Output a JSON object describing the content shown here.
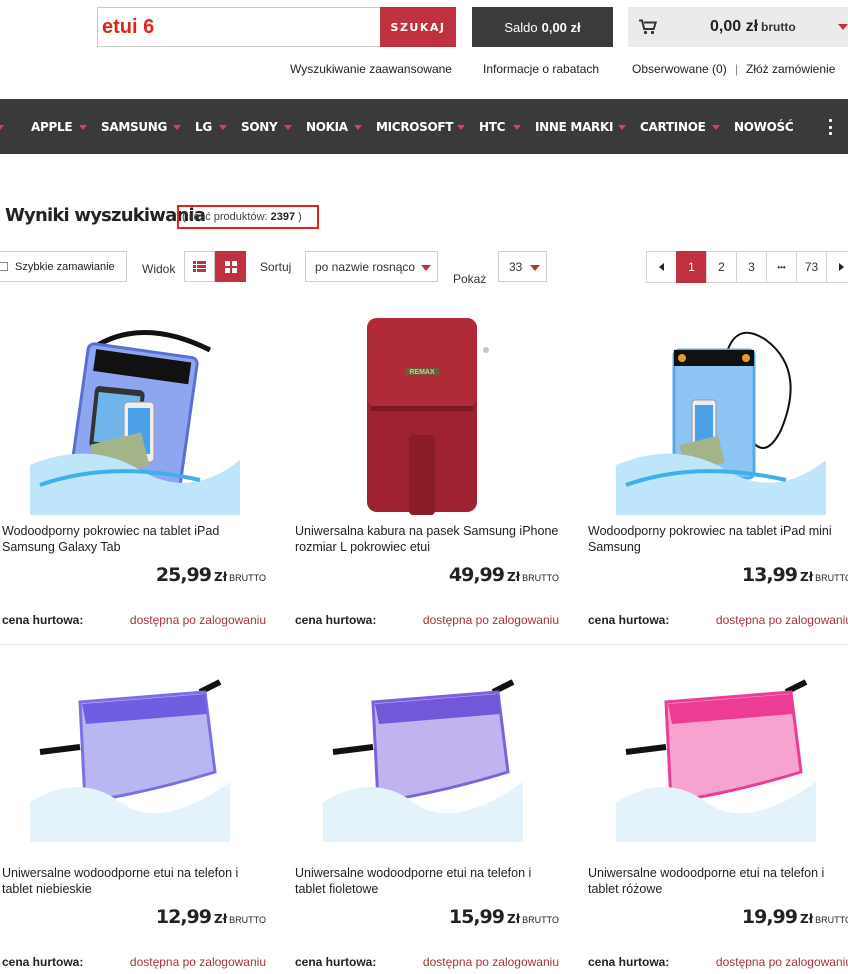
{
  "search": {
    "value": "etui 6",
    "button_label": "SZUKAJ"
  },
  "account": {
    "saldo_label": "Saldo",
    "saldo_value": "0,00 zł"
  },
  "cart": {
    "amount": "0,00 zł",
    "unit": "brutto"
  },
  "top_links": {
    "advanced_search": "Wyszukiwanie zaawansowane",
    "discounts": "Informacje o rabatach",
    "watched": "Obserwowane (0)",
    "separator": "|",
    "place_order": "Złóż zamówienie"
  },
  "nav": {
    "items": [
      "APPLE",
      "SAMSUNG",
      "LG",
      "SONY",
      "NOKIA",
      "MICROSOFT",
      "HTC",
      "INNE MARKI",
      "CARTINOE",
      "NOWOŚĆ"
    ]
  },
  "results": {
    "title": "Wyniki wyszukiwania",
    "count_prefix": "( ilość produktów:",
    "count_value": "2397",
    "count_suffix": ")"
  },
  "toolbar": {
    "quick_order": "Szybkie zamawianie",
    "view_label": "Widok",
    "sort_label": "Sortuj",
    "sort_value": "po nazwie rosnąco",
    "show_label": "Pokaż",
    "show_value": "33"
  },
  "pagination": {
    "pages": [
      "1",
      "2",
      "3",
      "•••",
      "73"
    ],
    "active": "1"
  },
  "products": [
    {
      "name": "Wodoodporny pokrowiec na tablet iPad Samsung Galaxy Tab",
      "price": "25,99",
      "currency": "Zł",
      "price_suffix": "BRUTTO",
      "wholesale_label": "cena hurtowa:",
      "wholesale_value": "dostępna po zalogowaniu"
    },
    {
      "name": "Uniwersalna kabura na pasek Samsung iPhone rozmiar L pokrowiec etui",
      "price": "49,99",
      "currency": "Zł",
      "price_suffix": "BRUTTO",
      "wholesale_label": "cena hurtowa:",
      "wholesale_value": "dostępna po zalogowaniu",
      "brand_mark": "REMAX"
    },
    {
      "name": "Wodoodporny pokrowiec na tablet iPad mini Samsung",
      "price": "13,99",
      "currency": "Zł",
      "price_suffix": "BRUTTO",
      "wholesale_label": "cena hurtowa:",
      "wholesale_value": "dostępna po zalogowaniu"
    },
    {
      "name": "Uniwersalne wodoodporne etui na telefon i tablet niebieskie",
      "price": "12,99",
      "currency": "Zł",
      "price_suffix": "BRUTTO",
      "wholesale_label": "cena hurtowa:",
      "wholesale_value": "dostępna po zalogowaniu"
    },
    {
      "name": "Uniwersalne wodoodporne etui na telefon i tablet fioletowe",
      "price": "15,99",
      "currency": "Zł",
      "price_suffix": "BRUTTO",
      "wholesale_label": "cena hurtowa:",
      "wholesale_value": "dostępna po zalogowaniu"
    },
    {
      "name": "Uniwersalne wodoodporne etui na telefon i tablet różowe",
      "price": "19,99",
      "currency": "Zł",
      "price_suffix": "BRUTTO",
      "wholesale_label": "cena hurtowa:",
      "wholesale_value": "dostępna po zalogowaniu"
    }
  ],
  "colors": {
    "accent": "#c0313f",
    "nav_bg": "#3a3a3a",
    "highlight": "#e2231a"
  },
  "icons": {
    "cart": "cart-icon",
    "list_view": "list-view-icon",
    "grid_view": "grid-view-icon",
    "more": "more-vertical-icon"
  }
}
